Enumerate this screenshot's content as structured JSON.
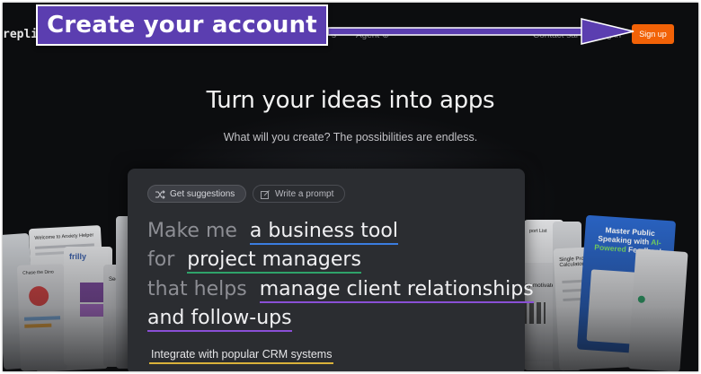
{
  "nav": {
    "logo": "repli",
    "items": [
      {
        "label": "s"
      },
      {
        "label": "Agent ⊕"
      },
      {
        "label": "Contact sal"
      },
      {
        "label": "g in"
      }
    ],
    "signup_label": "Sign up"
  },
  "callout": {
    "label": "Create your account",
    "color": "#5b3eb0"
  },
  "hero": {
    "title": "Turn your ideas into apps",
    "subtitle": "What will you create? The possibilities are endless."
  },
  "prompt": {
    "tabs": [
      {
        "label": "Get suggestions",
        "icon": "shuffle-icon",
        "active": true
      },
      {
        "label": "Write a prompt",
        "icon": "edit-icon",
        "active": false
      }
    ],
    "lines": [
      {
        "prefix": "Make me",
        "highlight": "a business tool"
      },
      {
        "prefix": "for",
        "highlight": "project managers"
      },
      {
        "prefix": "that helps",
        "highlight": "manage client relationships"
      },
      {
        "prefix": "",
        "highlight": "and follow-ups"
      }
    ],
    "integration": "Integrate with popular CRM systems"
  },
  "previews": {
    "left_card_1": "Welcome to Anxiety Helper",
    "left_card_2": "Chase the Dino",
    "left_card_3": "frilly",
    "left_card_4": "See po",
    "right_card_1": "port List",
    "right_card_2": "stay motivated",
    "right_card_3": "Single Property Loan Calculator",
    "right_card_4": "Master Public Speaking with",
    "right_card_4_highlight": "AI-Powered",
    "right_card_4_tail": "Feedback"
  },
  "colors": {
    "accent": "#f26207",
    "background": "#0c0d0f",
    "panel": "#2b2d31"
  }
}
